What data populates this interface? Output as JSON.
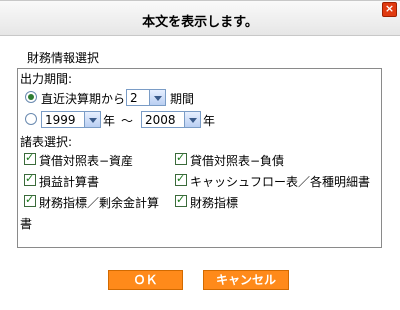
{
  "dialog": {
    "title": "本文を表示します。",
    "close_icon": "close-icon"
  },
  "section": {
    "legend": "財務情報選択"
  },
  "period": {
    "label": "出力期間:",
    "option_recent": {
      "prefix": "直近決算期から",
      "value": "2",
      "suffix": "期間",
      "selected": true
    },
    "option_range": {
      "from_value": "1999",
      "from_unit": "年",
      "tilde": "～",
      "to_value": "2008",
      "to_unit": "年",
      "selected": false
    }
  },
  "statements": {
    "label": "諸表選択:",
    "items": [
      {
        "label": "貸借対照表−資産",
        "checked": true
      },
      {
        "label": "貸借対照表−負債",
        "checked": true
      },
      {
        "label": "損益計算書",
        "checked": true
      },
      {
        "label": "キャッシュフロー表／各種明細書",
        "checked": true
      },
      {
        "label": "財務指標／剰余金計算",
        "label_cont": "書",
        "checked": true
      },
      {
        "label": "財務指標",
        "checked": true
      }
    ]
  },
  "buttons": {
    "ok": "ＯＫ",
    "cancel": "キャンセル"
  },
  "colors": {
    "accent_orange": "#ff8a1a",
    "radio_green": "#2e7d32",
    "check_green": "#1a7a1a"
  }
}
